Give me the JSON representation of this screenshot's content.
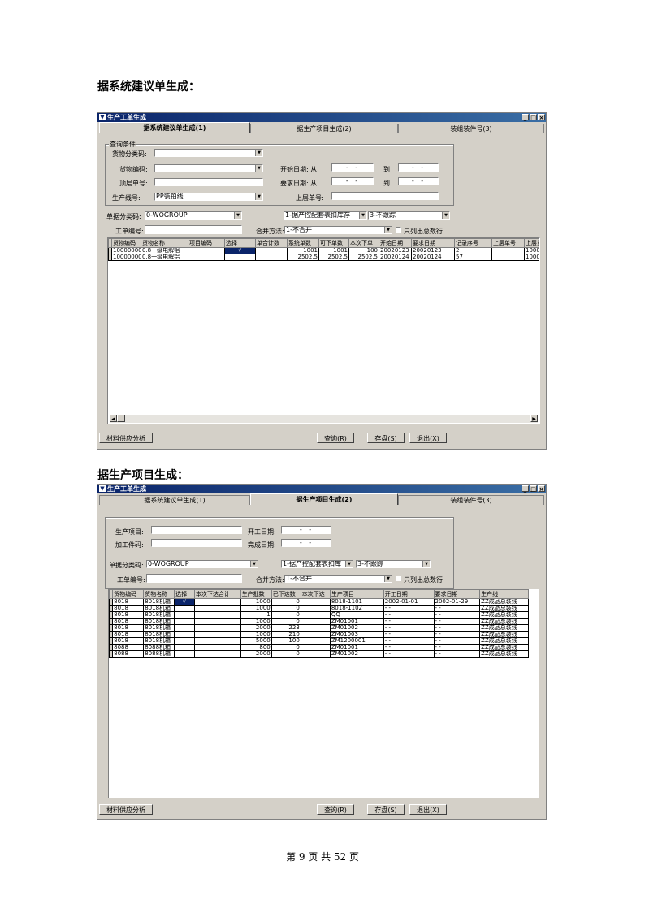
{
  "doc": {
    "heading1": "据系统建议单生成：",
    "heading2": "据生产项目生成：",
    "footer": "第 9 页 共 52 页"
  },
  "win1": {
    "title": "生产工单生成",
    "controls": [
      "_",
      "□",
      "×"
    ],
    "tabs": [
      "据系统建议单生成(1)",
      "据生产项目生成(2)",
      "装组装件号(3)"
    ],
    "query_group": "查询条件",
    "labels": {
      "category": "货物分类码:",
      "item_code": "货物编码:",
      "top_order": "顶层单号:",
      "line": "生产线号:",
      "start_date": "开始日期: 从",
      "req_date": "要求日期: 从",
      "to1": "到",
      "to2": "到",
      "upper_order": "上层单号:",
      "doc_category": "单据分类码:",
      "order_no": "工单编号:",
      "merge": "合并方法:",
      "total_only": "只列出总数行"
    },
    "values": {
      "line": "PP装铂线",
      "date_blank": "-  -",
      "doc_category": "0-WOGROUP",
      "combo1": "1-据产控配套表扣库存",
      "combo2": "3-不跟踪",
      "merge": "1-不合并"
    },
    "columns": [
      "货物编码",
      "货物名称",
      "项目编码",
      "选择",
      "单合计数",
      "系统单数",
      "可下单数",
      "本次下单",
      "开始日期",
      "要求日期",
      "记录序号",
      "上层单号",
      "上层货"
    ],
    "rows": [
      [
        "10000000",
        "0.8一级电解铝",
        "",
        "√",
        "",
        "1001",
        "1001",
        "100",
        "20020123",
        "20020123",
        "2",
        "",
        "100000"
      ],
      [
        "10000000",
        "0.8一级电解铝",
        "",
        "",
        "",
        "2502.5",
        "2502.5",
        "2502.5",
        "20020124",
        "20020124",
        "57",
        "",
        "100000"
      ]
    ],
    "buttons": {
      "material": "材料供应分析",
      "query": "查询(R)",
      "save": "存盘(S)",
      "exit": "退出(X)"
    }
  },
  "win2": {
    "title": "生产工单生成",
    "controls": [
      "_",
      "□",
      "×"
    ],
    "tabs": [
      "据系统建议单生成(1)",
      "据生产项目生成(2)",
      "装组装件号(3)"
    ],
    "labels": {
      "project": "生产项目:",
      "part_no": "加工件码:",
      "start_date": "开工日期:",
      "finish_date": "完成日期:",
      "doc_category": "单据分类码:",
      "order_no": "工单编号:",
      "merge": "合并方法:",
      "total_only": "只列出总数行"
    },
    "values": {
      "date_blank": "-  -",
      "doc_category": "0-WOGROUP",
      "combo1": "1-据产控配套表扣库",
      "combo2": "3-不跟踪",
      "merge": "1-不合并"
    },
    "columns": [
      "货物编码",
      "货物名称",
      "选择",
      "本次下达合计",
      "生产批数",
      "已下达数",
      "本次下达",
      "生产项目",
      "开工日期",
      "要求日期",
      "生产线"
    ],
    "rows": [
      [
        "8018",
        "8018机箱",
        "√",
        "",
        "1000",
        "0",
        "",
        "8018-1101",
        "2002-01-01",
        "2002-01-29",
        "ZZ成品总装线"
      ],
      [
        "8018",
        "8018机箱",
        "",
        "",
        "1000",
        "0",
        "",
        "8018-1102",
        "-  -",
        "-  -",
        "ZZ成品总装线"
      ],
      [
        "8018",
        "8018机箱",
        "",
        "",
        "1",
        "0",
        "",
        "QQ",
        "-  -",
        "-  -",
        "ZZ成品总装线"
      ],
      [
        "8018",
        "8018机箱",
        "",
        "",
        "1000",
        "0",
        "",
        "ZM01001",
        "-  -",
        "-  -",
        "ZZ成品总装线"
      ],
      [
        "8018",
        "8018机箱",
        "",
        "",
        "2000",
        "223",
        "",
        "ZM01002",
        "-  -",
        "-  -",
        "ZZ成品总装线"
      ],
      [
        "8018",
        "8018机箱",
        "",
        "",
        "1000",
        "210",
        "",
        "ZM01003",
        "-  -",
        "-  -",
        "ZZ成品总装线"
      ],
      [
        "8018",
        "8018机箱",
        "",
        "",
        "5000",
        "100",
        "",
        "ZM1200001",
        "-  -",
        "-  -",
        "ZZ成品总装线"
      ],
      [
        "8088",
        "8088机箱",
        "",
        "",
        "800",
        "0",
        "",
        "ZM01001",
        "-  -",
        "-  -",
        "ZZ成品总装线"
      ],
      [
        "8088",
        "8088机箱",
        "",
        "",
        "2000",
        "0",
        "",
        "ZM01002",
        "-  -",
        "-  -",
        "ZZ成品总装线"
      ]
    ],
    "buttons": {
      "material": "材料供应分析",
      "query": "查询(R)",
      "save": "存盘(S)",
      "exit": "退出(X)"
    }
  }
}
